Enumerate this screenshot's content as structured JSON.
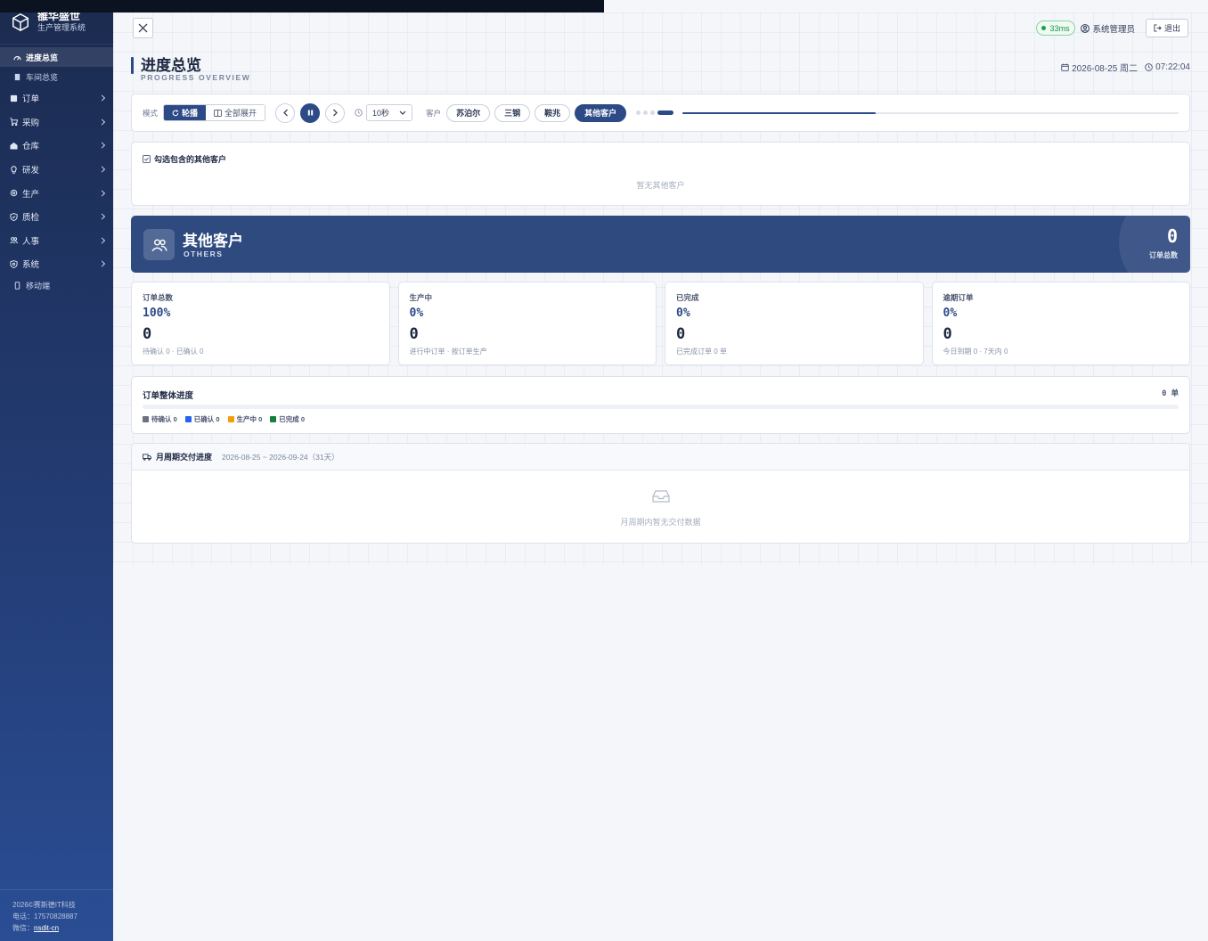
{
  "brand": {
    "name": "雒华盛世",
    "subtitle": "生产管理系统"
  },
  "sidebar": {
    "items": [
      {
        "label": "进度总览",
        "icon": "dashboard-icon",
        "active": true,
        "sub": true
      },
      {
        "label": "车间总览",
        "icon": "document-icon",
        "sub": true
      },
      {
        "label": "订单",
        "icon": "file-icon",
        "expandable": true
      },
      {
        "label": "采购",
        "icon": "cart-icon",
        "expandable": true
      },
      {
        "label": "仓库",
        "icon": "warehouse-icon",
        "expandable": true
      },
      {
        "label": "研发",
        "icon": "lightbulb-icon",
        "expandable": true
      },
      {
        "label": "生产",
        "icon": "gear-icon",
        "expandable": true
      },
      {
        "label": "质检",
        "icon": "shield-check-icon",
        "expandable": true
      },
      {
        "label": "人事",
        "icon": "users-icon",
        "expandable": true
      },
      {
        "label": "系统",
        "icon": "shield-icon",
        "expandable": true
      },
      {
        "label": "移动端",
        "icon": "mobile-icon",
        "sub": true
      }
    ],
    "footer": {
      "copyright": "2026©赛斯德IT科技",
      "phone": "电话：17570828887",
      "wechat_label": "微信：",
      "wechat": "nsdit-cn"
    }
  },
  "header": {
    "ping": "33ms",
    "user": "系统管理员",
    "logout": "退出",
    "title": "进度总览",
    "subtitle": "PROGRESS OVERVIEW",
    "date": "2026-08-25 周二",
    "time": "07:22:04"
  },
  "toolbar": {
    "mode_label": "模式",
    "mode_carousel": "轮播",
    "mode_expand": "全部展开",
    "interval": "10秒",
    "customer_label": "客户",
    "customers": [
      {
        "label": "苏泊尔",
        "active": false
      },
      {
        "label": "三钢",
        "active": false
      },
      {
        "label": "鞍兆",
        "active": false
      },
      {
        "label": "其他客户",
        "active": true
      }
    ],
    "carousel_progress": 0.39
  },
  "picker": {
    "title": "勾选包含的其他客户",
    "empty": "暂无其他客户"
  },
  "banner": {
    "title": "其他客户",
    "subtitle": "OTHERS",
    "count": "0",
    "count_label": "订单总数"
  },
  "stats": [
    {
      "label": "订单总数",
      "pct": "100%",
      "value": "0",
      "foot": "待确认 0 · 已确认 0"
    },
    {
      "label": "生产中",
      "pct": "0%",
      "value": "0",
      "foot": "进行中订单 · 按订单生产"
    },
    {
      "label": "已完成",
      "pct": "0%",
      "value": "0",
      "foot": "已完成订单 0 单"
    },
    {
      "label": "逾期订单",
      "pct": "0%",
      "value": "0",
      "foot": "今日到期 0 · 7天内 0"
    }
  ],
  "overall": {
    "title": "订单整体进度",
    "count": "0 单",
    "legend": [
      {
        "label": "待确认 0",
        "color": "#6b7280"
      },
      {
        "label": "已确认 0",
        "color": "#2563eb"
      },
      {
        "label": "生产中 0",
        "color": "#f59e0b"
      },
      {
        "label": "已完成 0",
        "color": "#15803d"
      }
    ]
  },
  "monthly": {
    "title": "月周期交付进度",
    "range": "2026-08-25 ~ 2026-09-24（31天）",
    "empty": "月周期内暂无交付数据"
  },
  "colors": {
    "primary": "#2c4a86",
    "sidebar": "#233c74",
    "ping_green": "#16a34a"
  }
}
